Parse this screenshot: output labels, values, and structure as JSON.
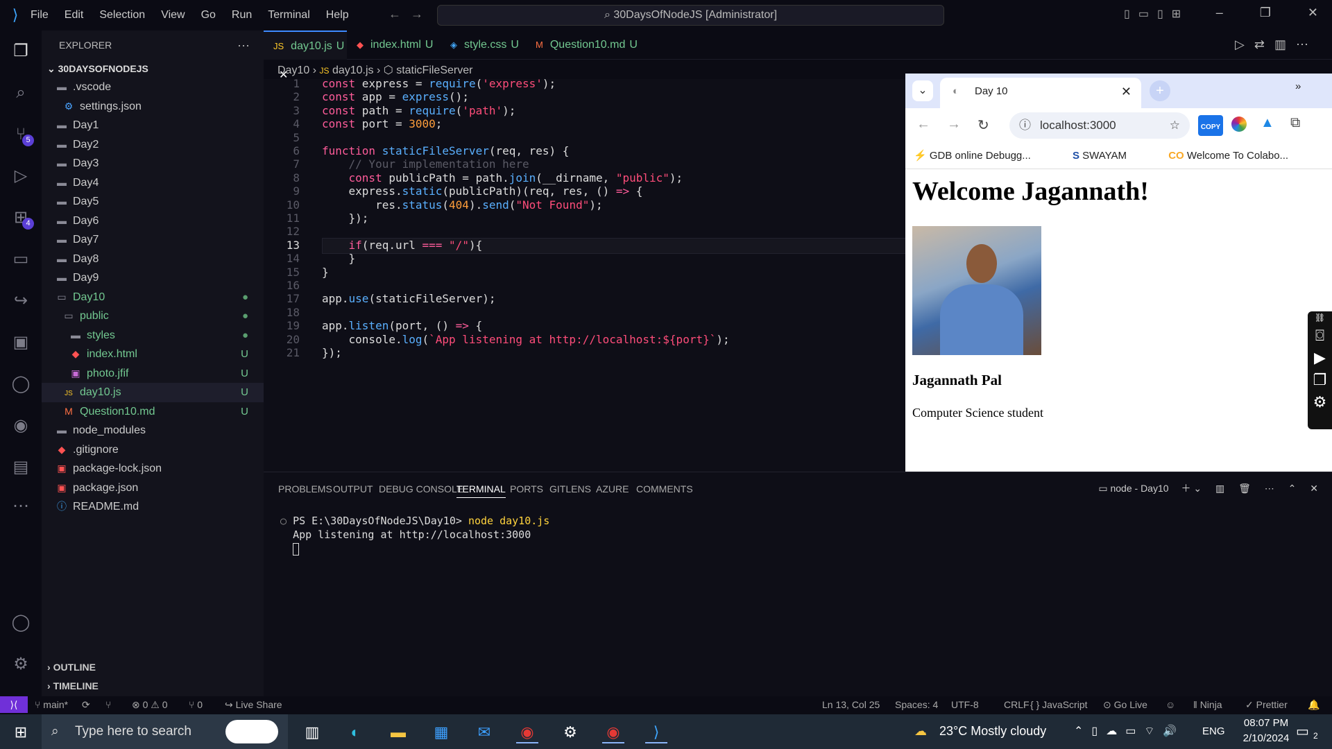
{
  "titlebar": {
    "menu": [
      "File",
      "Edit",
      "Selection",
      "View",
      "Go",
      "Run",
      "Terminal",
      "Help"
    ],
    "command_center": "30DaysOfNodeJS [Administrator]"
  },
  "activity_badges": {
    "source_control": "5",
    "extensions": "4"
  },
  "sidebar": {
    "title": "EXPLORER",
    "root": "30DAYSOFNODEJS",
    "items": [
      {
        "label": ".vscode",
        "icon": "folder-icon",
        "indent": 0,
        "status": ""
      },
      {
        "label": "settings.json",
        "icon": "settings-file-icon",
        "indent": 1,
        "status": ""
      },
      {
        "label": "Day1",
        "icon": "folder-icon",
        "indent": 0,
        "status": ""
      },
      {
        "label": "Day2",
        "icon": "folder-icon",
        "indent": 0,
        "status": ""
      },
      {
        "label": "Day3",
        "icon": "folder-icon",
        "indent": 0,
        "status": ""
      },
      {
        "label": "Day4",
        "icon": "folder-icon",
        "indent": 0,
        "status": ""
      },
      {
        "label": "Day5",
        "icon": "folder-icon",
        "indent": 0,
        "status": ""
      },
      {
        "label": "Day6",
        "icon": "folder-icon",
        "indent": 0,
        "status": ""
      },
      {
        "label": "Day7",
        "icon": "folder-icon",
        "indent": 0,
        "status": ""
      },
      {
        "label": "Day8",
        "icon": "folder-icon",
        "indent": 0,
        "status": ""
      },
      {
        "label": "Day9",
        "icon": "folder-icon",
        "indent": 0,
        "status": ""
      },
      {
        "label": "Day10",
        "icon": "folder-open-icon",
        "indent": 0,
        "status": "●"
      },
      {
        "label": "public",
        "icon": "folder-open-icon",
        "indent": 1,
        "status": "●"
      },
      {
        "label": "styles",
        "icon": "folder-icon",
        "indent": 2,
        "status": "●"
      },
      {
        "label": "index.html",
        "icon": "html-file-icon",
        "indent": 2,
        "status": "U"
      },
      {
        "label": "photo.jfif",
        "icon": "image-file-icon",
        "indent": 2,
        "status": "U"
      },
      {
        "label": "day10.js",
        "icon": "js-file-icon",
        "indent": 1,
        "status": "U"
      },
      {
        "label": "Question10.md",
        "icon": "markdown-file-icon",
        "indent": 1,
        "status": "U"
      },
      {
        "label": "node_modules",
        "icon": "folder-icon",
        "indent": 0,
        "status": ""
      },
      {
        "label": ".gitignore",
        "icon": "git-file-icon",
        "indent": 0,
        "status": ""
      },
      {
        "label": "package-lock.json",
        "icon": "npm-file-icon",
        "indent": 0,
        "status": ""
      },
      {
        "label": "package.json",
        "icon": "npm-file-icon",
        "indent": 0,
        "status": ""
      },
      {
        "label": "README.md",
        "icon": "info-file-icon",
        "indent": 0,
        "status": ""
      }
    ],
    "outline": "OUTLINE",
    "timeline": "TIMELINE"
  },
  "tabs": [
    {
      "label": "day10.js",
      "flag": "U",
      "icon": "js-file-icon",
      "active": true
    },
    {
      "label": "index.html",
      "flag": "U",
      "icon": "html-file-icon",
      "active": false
    },
    {
      "label": "style.css",
      "flag": "U",
      "icon": "css-file-icon",
      "active": false
    },
    {
      "label": "Question10.md",
      "flag": "U",
      "icon": "markdown-file-icon",
      "active": false
    }
  ],
  "breadcrumb": [
    "Day10",
    "day10.js",
    "staticFileServer"
  ],
  "code": {
    "current_line": 13,
    "lines": [
      "const express = require('express');",
      "const app = express();",
      "const path = require('path');",
      "const port = 3000;",
      "",
      "function staticFileServer(req, res) {",
      "    // Your implementation here",
      "    const publicPath = path.join(__dirname, \"public\");",
      "    express.static(publicPath)(req, res, () => {",
      "        res.status(404).send(\"Not Found\");",
      "    });",
      "",
      "    if(req.url === \"/\"){",
      "    }",
      "}",
      "",
      "app.use(staticFileServer);",
      "",
      "app.listen(port, () => {",
      "    console.log(`App listening at http://localhost:${port}`);",
      "});"
    ]
  },
  "browser": {
    "tab_title": "Day 10",
    "url": "localhost:3000",
    "bookmarks": [
      "GDB online Debugg...",
      "SWAYAM",
      "Welcome To Colabo..."
    ],
    "page": {
      "heading": "Welcome Jagannath!",
      "name": "Jagannath Pal",
      "role": "Computer Science student"
    },
    "copy_badge": "COPY"
  },
  "panel": {
    "tabs": [
      "PROBLEMS",
      "OUTPUT",
      "DEBUG CONSOLE",
      "TERMINAL",
      "PORTS",
      "GITLENS",
      "AZURE",
      "COMMENTS"
    ],
    "active_tab": "TERMINAL",
    "terminal_name": "node - Day10",
    "prompt": "PS E:\\30DaysOfNodeJS\\Day10>",
    "command": "node day10.js",
    "output": "App listening at http://localhost:3000"
  },
  "statusbar": {
    "branch": "main*",
    "problems": "⊗ 0 ⚠ 0",
    "ports": "0",
    "live_share": "Live Share",
    "position": "Ln 13, Col 25",
    "spaces": "Spaces: 4",
    "encoding": "UTF-8",
    "eol": "CRLF",
    "language": "JavaScript",
    "go_live": "Go Live",
    "theme": "Ninja",
    "prettier": "Prettier"
  },
  "taskbar": {
    "search_placeholder": "Type here to search",
    "weather": "23°C  Mostly cloudy",
    "lang": "ENG",
    "time": "08:07 PM",
    "date": "2/10/2024",
    "notifications": "2"
  },
  "colors": {
    "accent": "#3e8bff",
    "keyword": "#ff5c9a",
    "function": "#5ab0ff",
    "string": "#ff4d7a",
    "number": "#ff9e3b"
  }
}
